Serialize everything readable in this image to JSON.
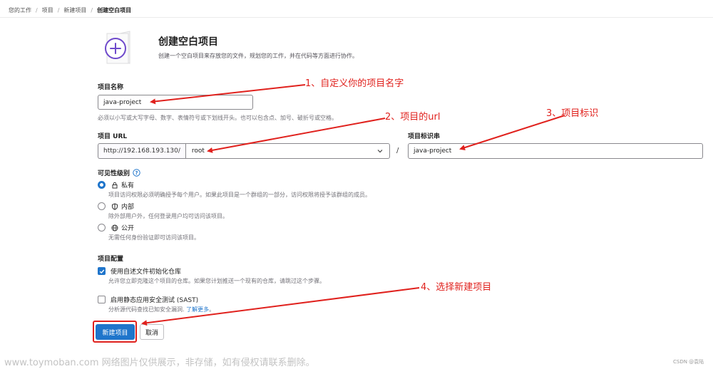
{
  "breadcrumb": {
    "items": [
      "您的工作",
      "项目",
      "新建项目"
    ],
    "current": "创建空白项目"
  },
  "header": {
    "title": "创建空白项目",
    "description": "创建一个空白项目来存放您的文件，规划您的工作，并在代码等方面进行协作。"
  },
  "project_name": {
    "label": "项目名称",
    "value": "java-project",
    "help": "必须以小写或大写字母、数字、表情符号或下划线开头。也可以包含点、加号、破折号或空格。"
  },
  "project_url": {
    "label": "项目 URL",
    "prefix": "http://192.168.193.130/",
    "namespace": "root",
    "separator": "/"
  },
  "project_slug": {
    "label": "项目标识串",
    "value": "java-project"
  },
  "visibility": {
    "label": "可见性级别",
    "options": [
      {
        "name": "私有",
        "desc": "项目访问权限必须明确授予每个用户。如果此项目是一个群组的一部分，访问权限将授予该群组的成员。",
        "checked": true
      },
      {
        "name": "内部",
        "desc": "除外部用户外，任何登录用户均可访问该项目。",
        "checked": false
      },
      {
        "name": "公开",
        "desc": "无需任何身份验证即可访问该项目。",
        "checked": false
      }
    ]
  },
  "config": {
    "label": "项目配置",
    "readme": {
      "label": "使用自述文件初始化仓库",
      "desc": "允许您立即克隆这个项目的仓库。如果您计划推送一个现有的仓库，请跳过这个步骤。",
      "checked": true
    },
    "sast": {
      "label": "启用静态应用安全测试 (SAST)",
      "desc": "分析源代码查找已知安全漏洞.",
      "link": "了解更多",
      "after": "。",
      "checked": false
    }
  },
  "buttons": {
    "create": "新建项目",
    "cancel": "取消"
  },
  "annotations": {
    "a1": "1、自定义你的项目名字",
    "a2": "2、项目的url",
    "a3": "3、项目标识",
    "a4": "4、选择新建项目",
    "color": "#e0211d"
  },
  "watermark": "www.toymoban.com 网络图片仅供展示，非存储，如有侵权请联系删除。",
  "credit": "CSDN @袁陆",
  "colors": {
    "primary": "#1f75cb",
    "annotation": "#e0211d"
  }
}
